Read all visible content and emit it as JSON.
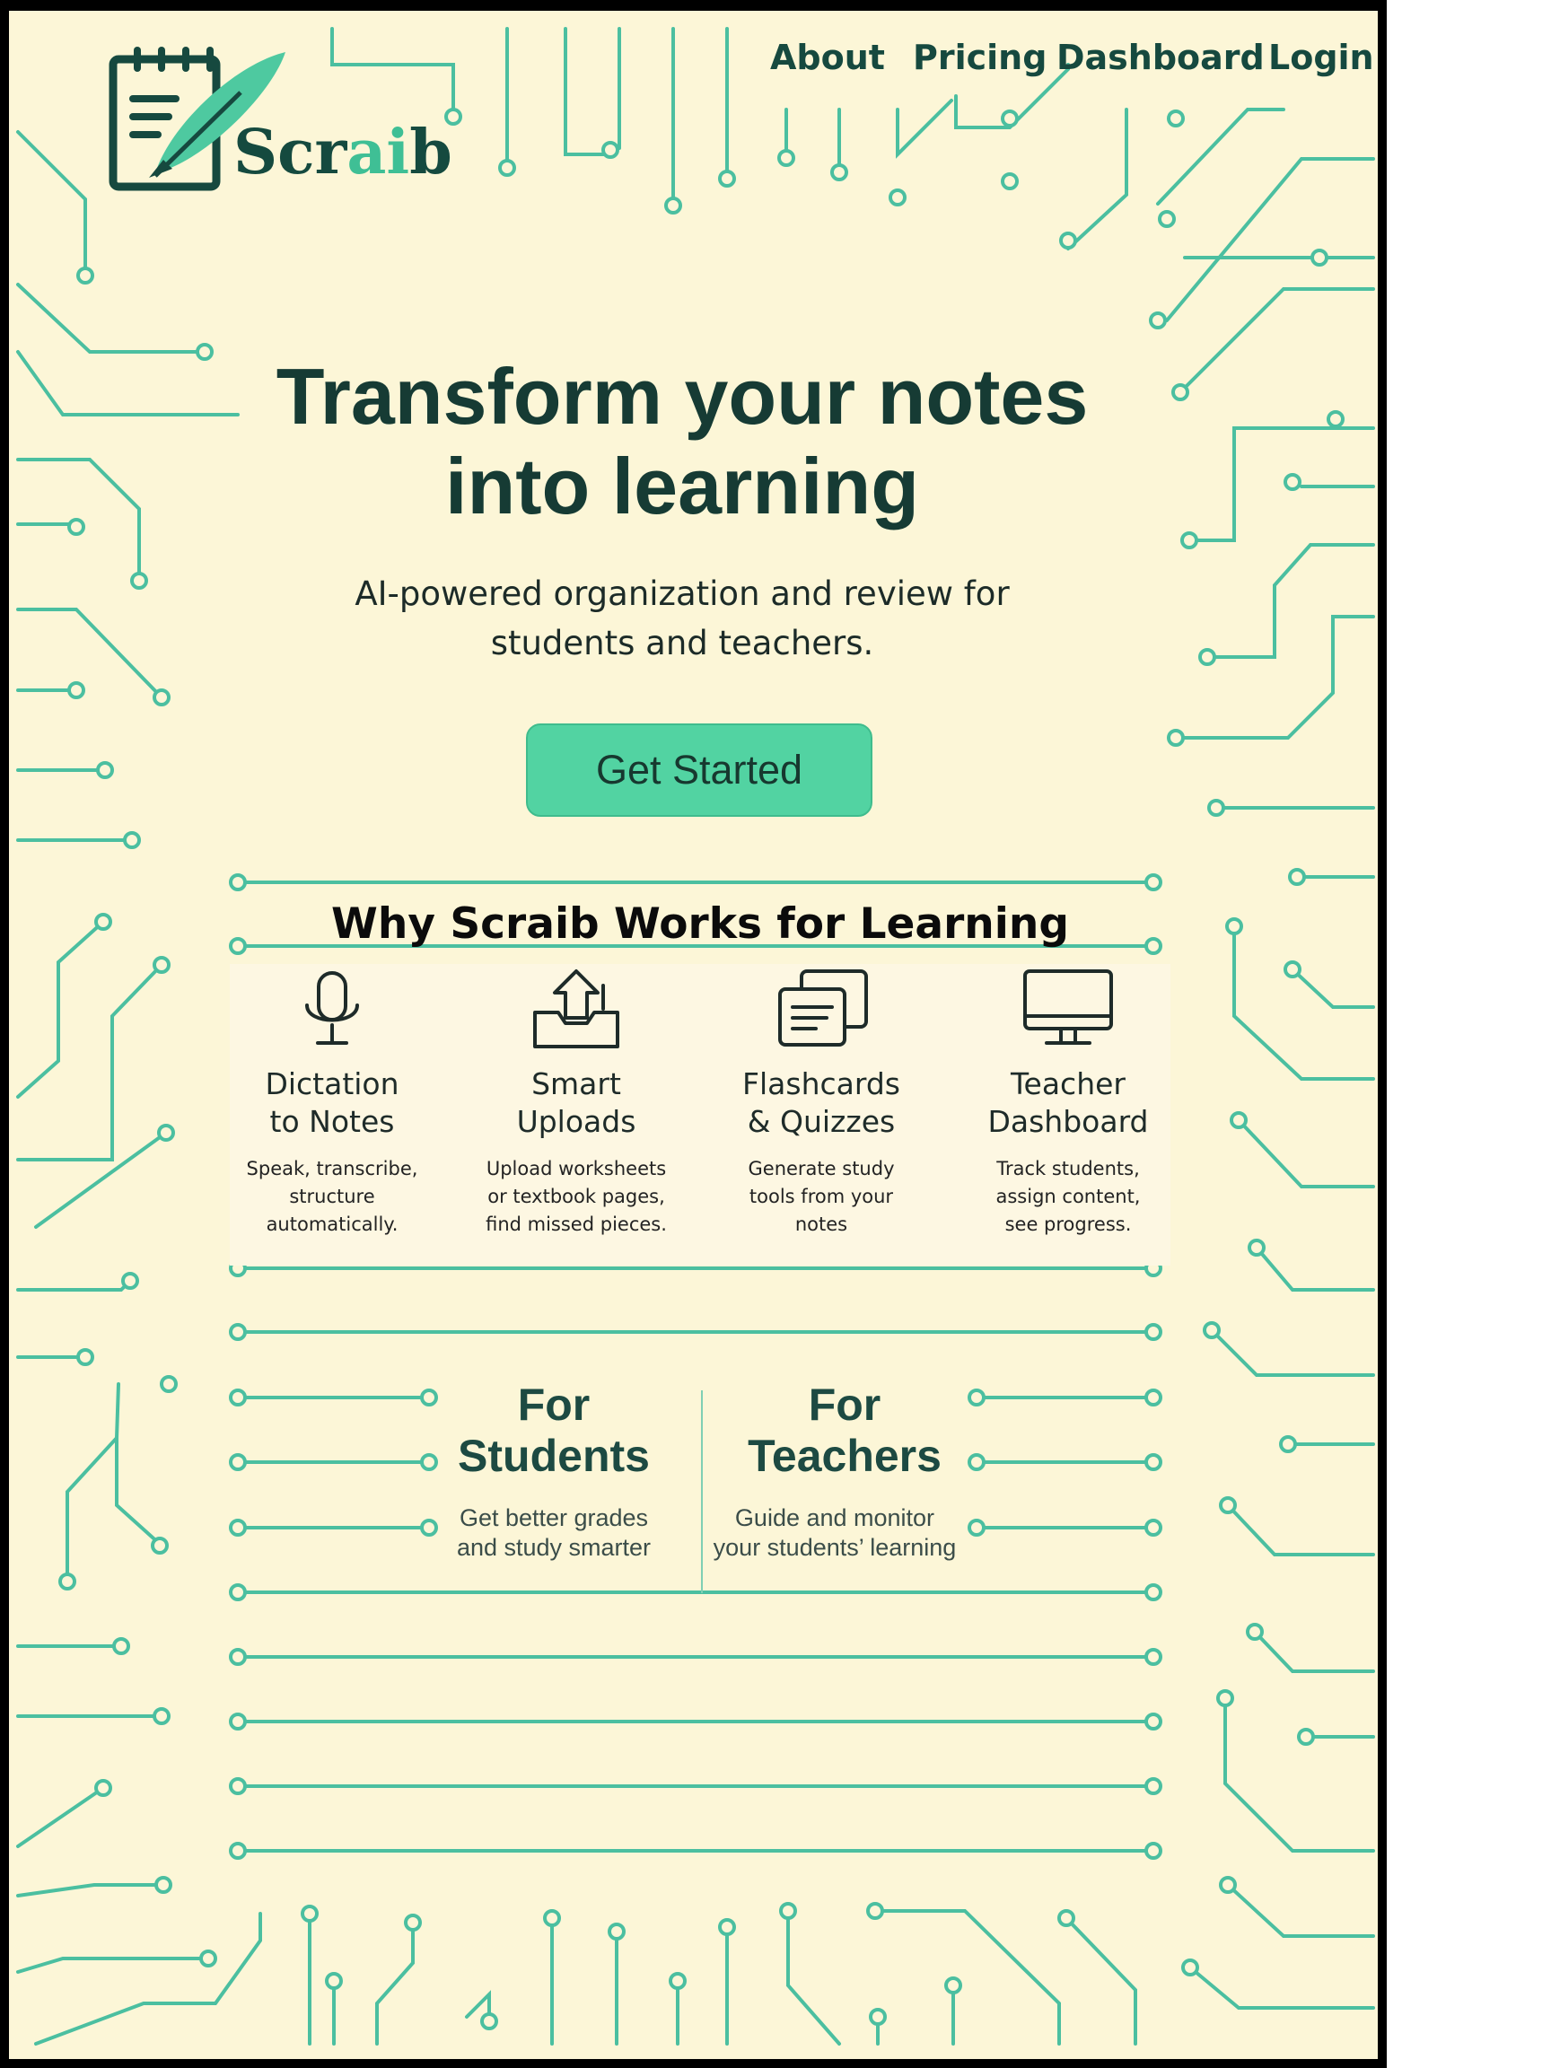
{
  "colors": {
    "background": "#fcf6d7",
    "accent": "#52d3a2",
    "circuit": "#4bbfa0",
    "dark_green": "#16493f"
  },
  "brand": {
    "name_prefix": "Scr",
    "name_highlight": "ai",
    "name_suffix": "b",
    "logo_icon": "notepad-quill-icon"
  },
  "nav": {
    "items": [
      "About",
      "Pricing",
      "Dashboard",
      "Login"
    ]
  },
  "hero": {
    "title_line1": "Transform your notes",
    "title_line2": "into learning",
    "subtitle_line1": "AI-powered organization and review for",
    "subtitle_line2": "students and teachers.",
    "cta_label": "Get Started"
  },
  "features": {
    "heading": "Why Scraib Works for Learning",
    "items": [
      {
        "icon": "microphone-icon",
        "name_line1": "Dictation",
        "name_line2": "to Notes",
        "desc_line1": "Speak, transcribe,",
        "desc_line2": "structure",
        "desc_line3": "automatically."
      },
      {
        "icon": "upload-tray-icon",
        "name_line1": "Smart",
        "name_line2": "Uploads",
        "desc_line1": "Upload worksheets",
        "desc_line2": "or textbook pages,",
        "desc_line3": "find missed pieces."
      },
      {
        "icon": "flashcards-icon",
        "name_line1": "Flashcards",
        "name_line2": "& Quizzes",
        "desc_line1": "Generate study",
        "desc_line2": "tools from your",
        "desc_line3": "notes"
      },
      {
        "icon": "monitor-icon",
        "name_line1": "Teacher",
        "name_line2": "Dashboard",
        "desc_line1": "Track students,",
        "desc_line2": "assign content,",
        "desc_line3": "see progress."
      }
    ]
  },
  "audiences": {
    "students": {
      "title_line1": "For",
      "title_line2": "Students",
      "desc_line1": "Get better grades",
      "desc_line2": "and study smarter"
    },
    "teachers": {
      "title_line1": "For",
      "title_line2": "Teachers",
      "desc_line1": "Guide and monitor",
      "desc_line2": "your students’ learning"
    }
  }
}
